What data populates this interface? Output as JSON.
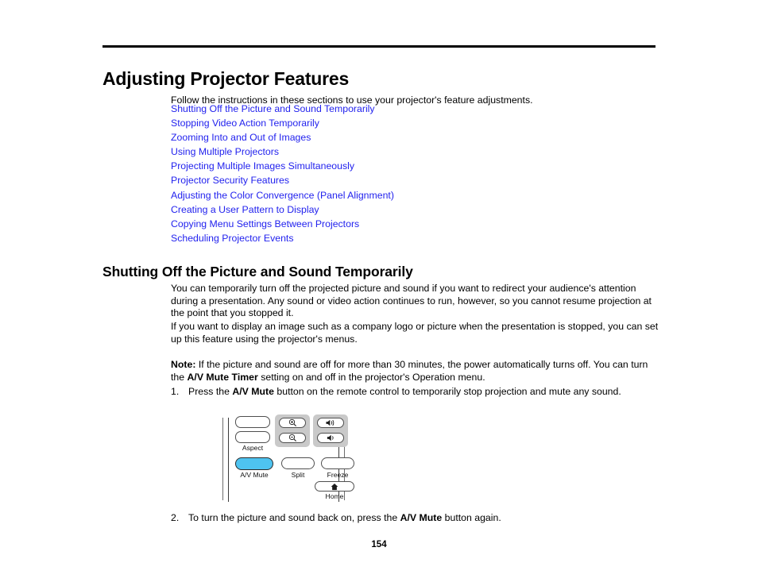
{
  "document": {
    "title": "Adjusting Projector Features",
    "intro": "Follow the instructions in these sections to use your projector's feature adjustments.",
    "page_number": "154",
    "link_color": "#2222ee",
    "links": [
      {
        "label": "Shutting Off the Picture and Sound Temporarily"
      },
      {
        "label": "Stopping Video Action Temporarily"
      },
      {
        "label": "Zooming Into and Out of Images"
      },
      {
        "label": "Using Multiple Projectors"
      },
      {
        "label": "Projecting Multiple Images Simultaneously"
      },
      {
        "label": "Projector Security Features"
      },
      {
        "label": "Adjusting the Color Convergence (Panel Alignment)"
      },
      {
        "label": "Creating a User Pattern to Display"
      },
      {
        "label": "Copying Menu Settings Between Projectors"
      },
      {
        "label": "Scheduling Projector Events"
      }
    ]
  },
  "section": {
    "heading": "Shutting Off the Picture and Sound Temporarily",
    "paragraph_1": "You can temporarily turn off the projected picture and sound if you want to redirect your audience's attention during a presentation. Any sound or video action continues to run, however, so you cannot resume projection at the point that you stopped it.",
    "paragraph_2": "If you want to display an image such as a company logo or picture when the presentation is stopped, you can set up this feature using the projector's menus.",
    "note": {
      "label": "Note:",
      "text_before": " If the picture and sound are off for more than 30 minutes, the power automatically turns off. You can turn the ",
      "emphasis": "A/V Mute Timer",
      "text_after": " setting on and off in the projector's Operation menu."
    },
    "steps": [
      {
        "number": "1.",
        "text_before": "Press the ",
        "emphasis": "A/V Mute",
        "text_after": " button on the remote control to temporarily stop projection and mute any sound."
      },
      {
        "number": "2.",
        "text_before": "To turn the picture and sound back on, press the ",
        "emphasis": "A/V Mute",
        "text_after": " button again."
      }
    ]
  },
  "remote_figure": {
    "alt": "Epson projector remote control detail",
    "highlight_color": "#4ec3f0",
    "panel_color": "#c9c9c9",
    "buttons": [
      {
        "name": "blank-top",
        "label": ""
      },
      {
        "name": "aspect",
        "label": "Aspect"
      },
      {
        "name": "zoom-in",
        "label": "",
        "icon": "magnifier-plus-icon"
      },
      {
        "name": "zoom-out",
        "label": "",
        "icon": "magnifier-minus-icon"
      },
      {
        "name": "volume-up",
        "label": "",
        "icon": "speaker-loud-icon"
      },
      {
        "name": "volume-down",
        "label": "",
        "icon": "speaker-quiet-icon"
      },
      {
        "name": "av-mute",
        "label": "A/V Mute",
        "highlighted": true
      },
      {
        "name": "split",
        "label": "Split"
      },
      {
        "name": "freeze",
        "label": "Freeze"
      },
      {
        "name": "home",
        "label": "Home",
        "icon": "house-icon"
      }
    ],
    "captions": {
      "aspect": "Aspect",
      "av_mute": "A/V Mute",
      "split": "Split",
      "freeze": "Freeze",
      "home": "Home"
    }
  }
}
